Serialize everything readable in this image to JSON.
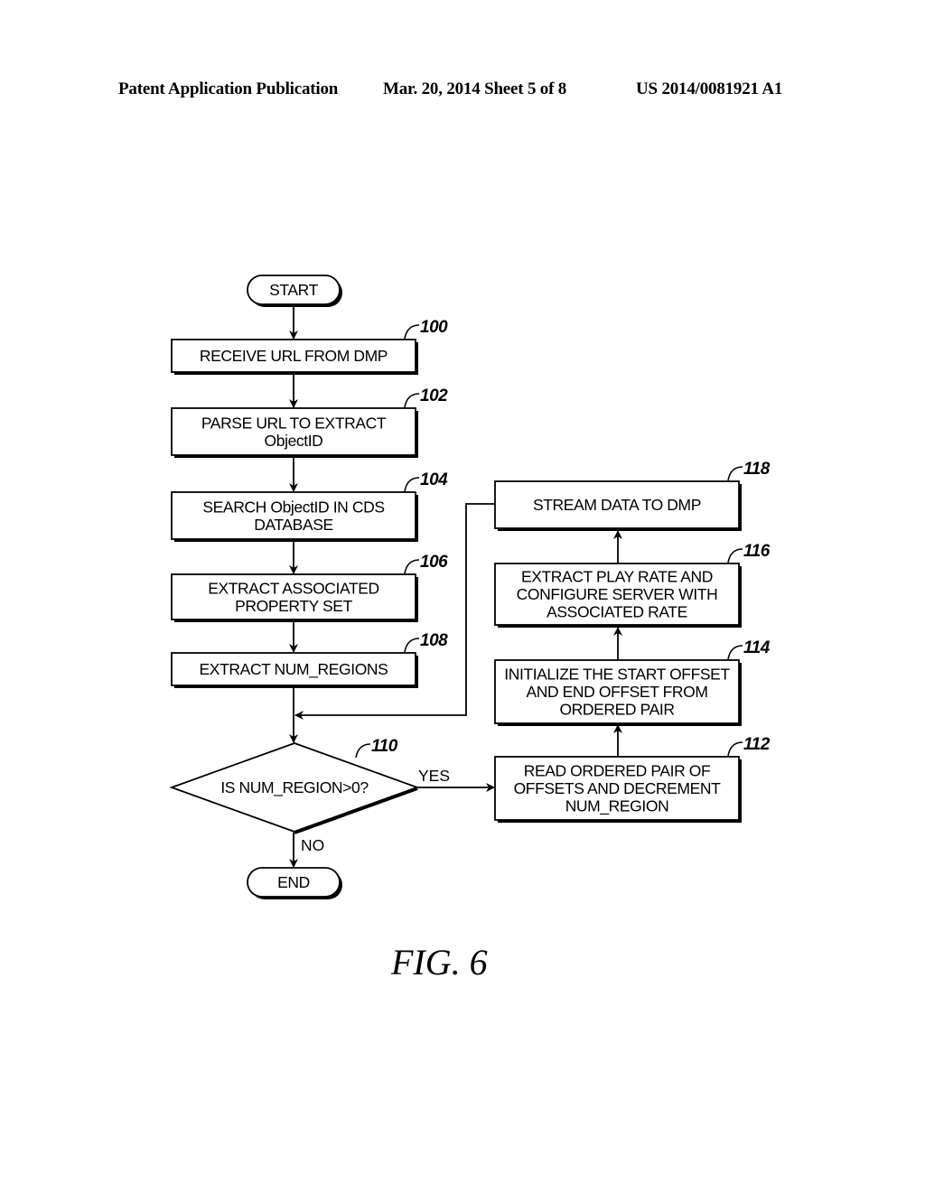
{
  "header": {
    "publication": "Patent Application Publication",
    "date_sheet": "Mar. 20, 2014  Sheet 5 of 8",
    "number": "US 2014/0081921 A1"
  },
  "figure_label": "FIG. 6",
  "flowchart": {
    "start": {
      "label": "START"
    },
    "end": {
      "label": "END"
    },
    "steps": [
      {
        "id": "100",
        "lines": [
          "RECEIVE URL FROM DMP"
        ]
      },
      {
        "id": "102",
        "lines": [
          "PARSE URL TO EXTRACT",
          "ObjectID"
        ]
      },
      {
        "id": "104",
        "lines": [
          "SEARCH ObjectID IN CDS",
          "DATABASE"
        ]
      },
      {
        "id": "106",
        "lines": [
          "EXTRACT ASSOCIATED",
          "PROPERTY SET"
        ]
      },
      {
        "id": "108",
        "lines": [
          "EXTRACT NUM_REGIONS"
        ]
      },
      {
        "id": "112",
        "lines": [
          "READ ORDERED PAIR OF",
          "OFFSETS AND DECREMENT",
          "NUM_REGION"
        ]
      },
      {
        "id": "114",
        "lines": [
          "INITIALIZE THE START OFFSET",
          "AND END OFFSET FROM",
          "ORDERED PAIR"
        ]
      },
      {
        "id": "116",
        "lines": [
          "EXTRACT PLAY RATE AND",
          "CONFIGURE SERVER WITH",
          "ASSOCIATED RATE"
        ]
      },
      {
        "id": "118",
        "lines": [
          "STREAM DATA TO DMP"
        ]
      }
    ],
    "decision": {
      "id": "110",
      "label": "IS NUM_REGION>0?",
      "yes_label": "YES",
      "no_label": "NO"
    }
  }
}
